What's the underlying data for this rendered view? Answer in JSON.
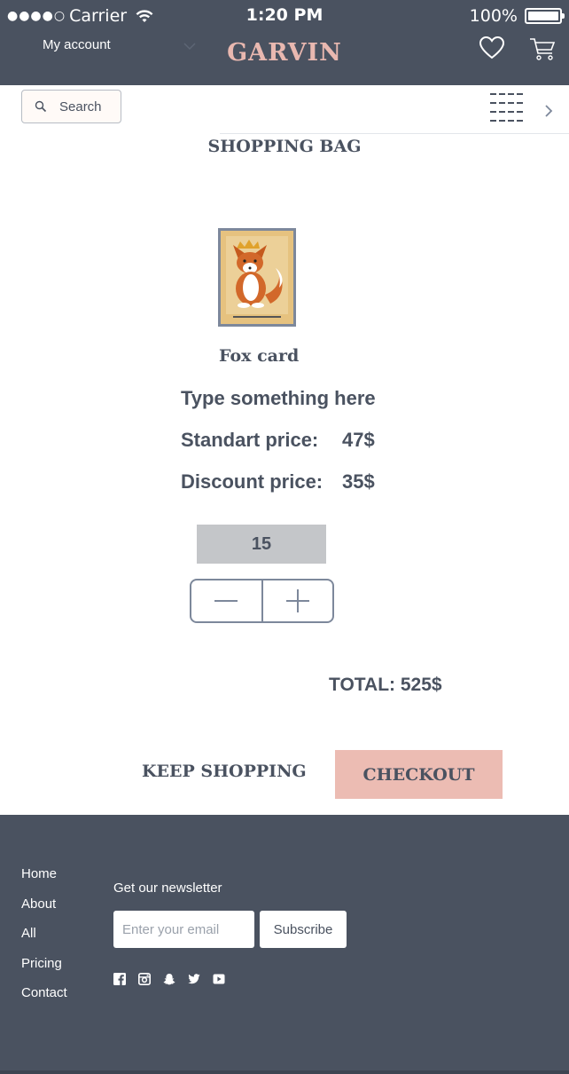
{
  "status_bar": {
    "signal": "●●●●○",
    "carrier": "Carrier",
    "time": "1:20 PM",
    "battery": "100%",
    "battery_level": 1.0
  },
  "header": {
    "account_label": "My account",
    "brand": "GARVIN",
    "icons": [
      "heart-icon",
      "cart-icon",
      "chevron-down-icon"
    ]
  },
  "search": {
    "label": "Search",
    "icons": [
      "search-icon",
      "menu-icon",
      "chevron-right-icon"
    ]
  },
  "page_title": "SHOPPING BAG",
  "product": {
    "name": "Fox card",
    "description": "Type something here",
    "standart_label": "Standart price:",
    "standart_value": "47$",
    "discount_label": "Discount price:",
    "discount_value": "35$",
    "quantity": "15"
  },
  "total": "TOTAL: 525$",
  "actions": {
    "keep_shopping": "KEEP SHOPPING",
    "checkout": "CHECKOUT"
  },
  "footer": {
    "nav": [
      "Home",
      "About",
      "All",
      "Pricing",
      "Contact"
    ],
    "newsletter_label": "Get our newsletter",
    "email_placeholder": "Enter your email",
    "subscribe": "Subscribe",
    "social_icons": [
      "facebook-icon",
      "instagram-icon",
      "snapchat-icon",
      "twitter-icon",
      "youtube-icon"
    ]
  },
  "colors": {
    "dark": "#4a5260",
    "brand_pink": "#e9b8b0",
    "checkout_bg": "#ecbcb3",
    "qty_bg": "#c4c6c9"
  }
}
